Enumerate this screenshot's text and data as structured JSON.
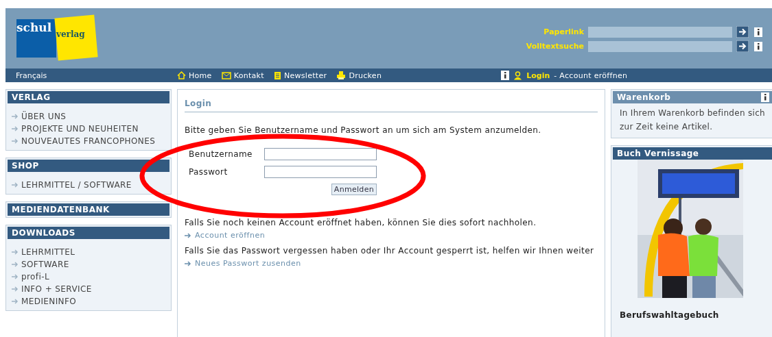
{
  "header": {
    "logo": {
      "part1": "schul",
      "part2": "verlag"
    },
    "quick_fields": [
      {
        "label": "Paperlink"
      },
      {
        "label": "Volltextsuche"
      }
    ]
  },
  "nav": {
    "language": "Français",
    "links": [
      {
        "label": "Home",
        "kind": "home"
      },
      {
        "label": "Kontakt",
        "kind": "mail"
      },
      {
        "label": "Newsletter",
        "kind": "doc"
      },
      {
        "label": "Drucken",
        "kind": "print"
      }
    ],
    "login": "Login",
    "account": "- Account eröffnen"
  },
  "sidebar": [
    {
      "title": "VERLAG",
      "items": [
        "ÜBER UNS",
        "PROJEKTE UND NEUHEITEN",
        "NOUVEAUTES FRANCOPHONES"
      ]
    },
    {
      "title": "SHOP",
      "items": [
        "LEHRMITTEL / SOFTWARE"
      ]
    },
    {
      "title": "MEDIENDATENBANK"
    },
    {
      "title": "DOWNLOADS",
      "items": [
        "LEHRMITTEL",
        "SOFTWARE",
        "profi-L",
        "INFO + SERVICE",
        "MEDIENINFO"
      ]
    }
  ],
  "main": {
    "title": "Login",
    "intro": "Bitte geben Sie Benutzername und Passwort an um sich am System anzumelden.",
    "fields": [
      {
        "label": "Benutzername"
      },
      {
        "label": "Passwort"
      }
    ],
    "button": "Anmelden",
    "blocks": [
      {
        "text": "Falls Sie noch keinen Account eröffnet haben, können Sie dies sofort nachholen.",
        "link": "Account eröffnen"
      },
      {
        "text": "Falls Sie das Passwort vergessen haben oder Ihr Account gesperrt ist, helfen wir Ihnen weiter",
        "link": "Neues Passwort zusenden"
      }
    ]
  },
  "right": {
    "cart": {
      "title": "Warenkorb",
      "text": "In Ihrem Warenkorb befinden sich zur Zeit keine Artikel."
    },
    "feature": {
      "title": "Buch Vernissage",
      "caption": "Berufswahltagebuch"
    }
  }
}
